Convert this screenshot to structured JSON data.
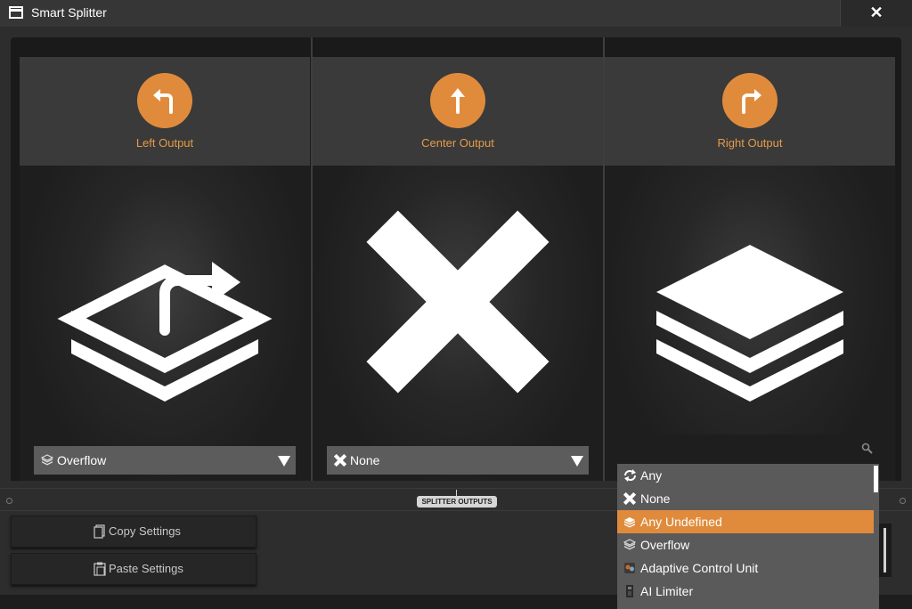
{
  "window": {
    "title": "Smart Splitter",
    "close_glyph": "✕"
  },
  "outputs": [
    {
      "label": "Left Output",
      "arrow_icon": "turn-left-arrow-icon",
      "big_icon": "overflow-stack-icon",
      "selection": "Overflow",
      "selection_icon": "overflow-icon"
    },
    {
      "label": "Center Output",
      "arrow_icon": "up-arrow-icon",
      "big_icon": "none-x-icon",
      "selection": "None",
      "selection_icon": "none-x-icon"
    },
    {
      "label": "Right Output",
      "arrow_icon": "turn-right-arrow-icon",
      "big_icon": "any-undefined-stack-icon",
      "selection": "",
      "selection_icon": ""
    }
  ],
  "search": {
    "placeholder": "",
    "value": ""
  },
  "dropdown_list": [
    {
      "label": "Any",
      "icon": "any-cycle-icon",
      "selected": false
    },
    {
      "label": "None",
      "icon": "none-x-icon",
      "selected": false
    },
    {
      "label": "Any Undefined",
      "icon": "any-undefined-icon",
      "selected": true
    },
    {
      "label": "Overflow",
      "icon": "overflow-icon",
      "selected": false
    },
    {
      "label": "Adaptive Control Unit",
      "icon": "adaptive-control-unit-icon",
      "selected": false
    },
    {
      "label": "AI Limiter",
      "icon": "ai-limiter-icon",
      "selected": false
    }
  ],
  "section_tag": "SPLITTER OUTPUTS",
  "buttons": {
    "copy": "Copy Settings",
    "paste": "Paste Settings"
  },
  "colors": {
    "accent": "#e08b3c",
    "accent_text": "#e59a48",
    "panel_bg": "#1f1f1f",
    "dropdown_bg": "#5c5c5c"
  }
}
